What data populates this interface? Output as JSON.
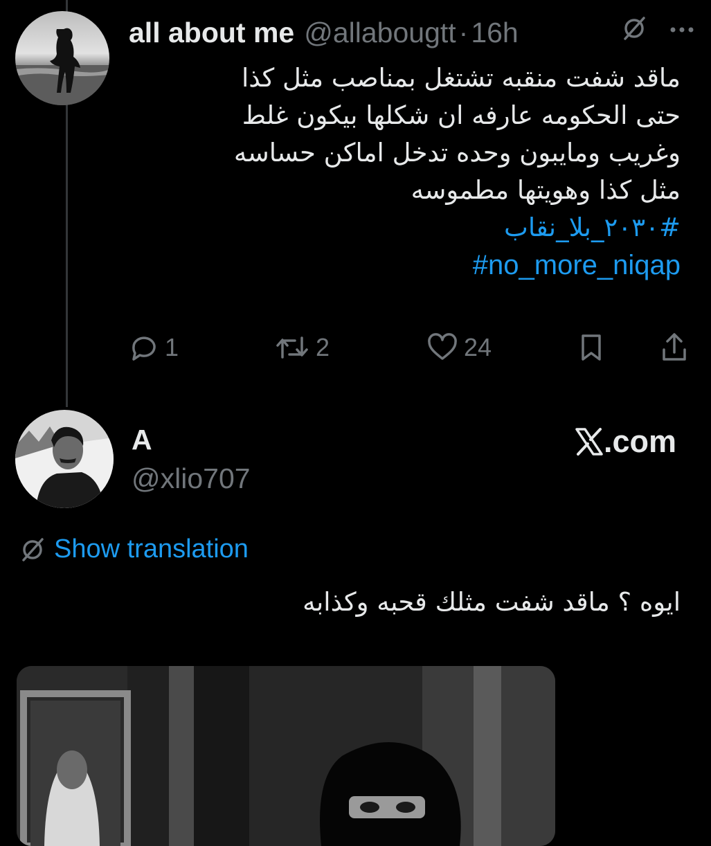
{
  "tweet": {
    "author_name": "all about me",
    "handle": "@allabougtt",
    "separator": "·",
    "time": "16h",
    "icons": [
      "grok-icon",
      "more-icon"
    ],
    "lines": [
      "ماقد شفت منقبه تشتغل بمناصب مثل كذا",
      "حتى الحكومه عارفه ان شكلها بيكون غلط",
      "وغريب ومايبون وحده تدخل اماكن حساسه",
      "مثل كذا وهويتها مطموسه"
    ],
    "hashtags": [
      "#٢٠٣٠_بلا_نقاب",
      "#no_more_niqap"
    ],
    "actions": {
      "replies": "1",
      "retweets": "2",
      "likes": "24"
    }
  },
  "quoted": {
    "name": "A",
    "handle": "@xlio707",
    "brand_suffix": ".com",
    "show_translation": "Show translation",
    "text": "ايوه ؟ ماقد شفت مثلك قحبه وكذابه"
  },
  "colors": {
    "background": "#000000",
    "text": "#e7e9ea",
    "muted": "#71767b",
    "link": "#1d9bf0"
  }
}
